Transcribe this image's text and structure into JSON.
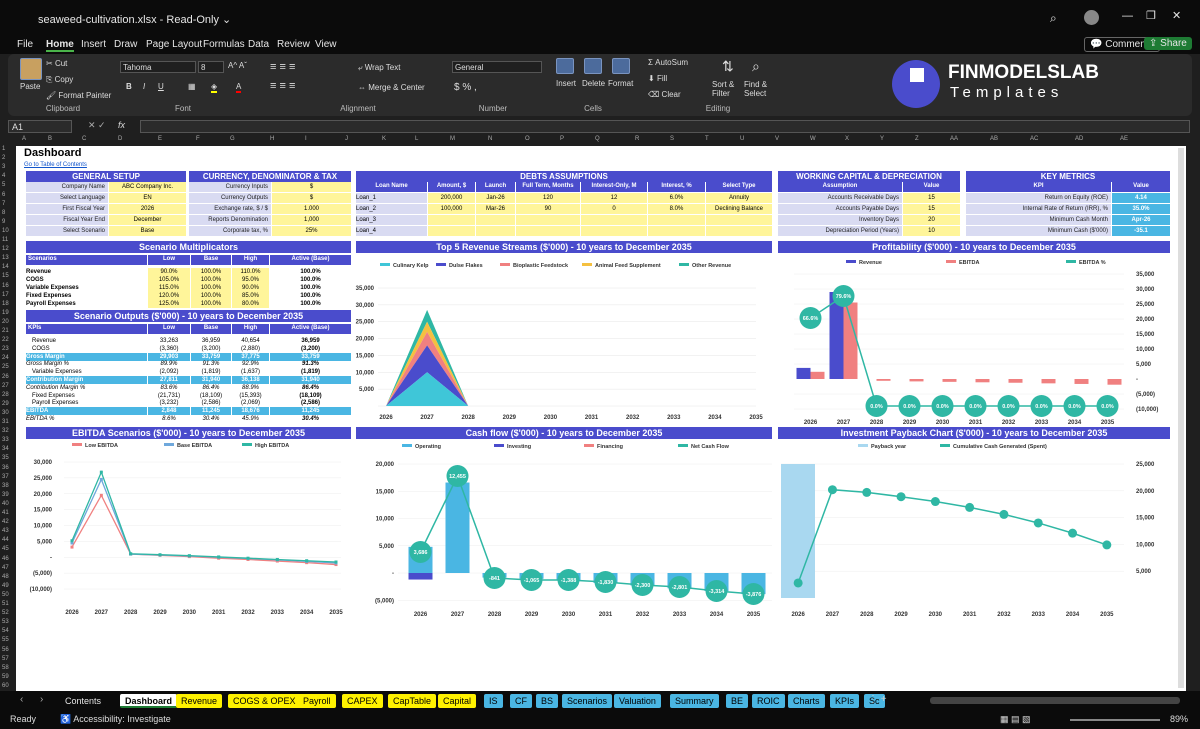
{
  "app": {
    "filename": "seaweed-cultivation.xlsx",
    "mode": "Read-Only",
    "comments_label": "Comments",
    "share_label": "Share"
  },
  "menu": [
    "File",
    "Home",
    "Insert",
    "Draw",
    "Page Layout",
    "Formulas",
    "Data",
    "Review",
    "View"
  ],
  "ribbon": {
    "paste": "Paste",
    "cut": "Cut",
    "copy": "Copy",
    "format_painter": "Format Painter",
    "clipboard": "Clipboard",
    "font_name": "Tahoma",
    "font_size": "8",
    "font": "Font",
    "wrap_text": "Wrap Text",
    "merge_center": "Merge & Center",
    "alignment": "Alignment",
    "number_format": "General",
    "number": "Number",
    "insert": "Insert",
    "delete": "Delete",
    "format": "Format",
    "cells": "Cells",
    "autosum": "AutoSum",
    "fill": "Fill",
    "clear": "Clear",
    "sort_filter": "Sort & Filter",
    "find_select": "Find & Select",
    "editing": "Editing",
    "brand_top": "FINMODELSLAB",
    "brand_bottom": "Templates"
  },
  "formula_bar": {
    "cell_ref": "A1",
    "fx": "fx"
  },
  "columns": [
    "A",
    "B",
    "C",
    "D",
    "E",
    "F",
    "G",
    "H",
    "I",
    "J",
    "K",
    "L",
    "M",
    "N",
    "O",
    "P",
    "Q",
    "R",
    "S",
    "T",
    "U",
    "V",
    "W",
    "X",
    "Y",
    "Z",
    "AA",
    "AB",
    "AC",
    "AD",
    "AE"
  ],
  "sheet": {
    "title": "Dashboard",
    "toc_link": "Go to Table of Contents",
    "general": {
      "title": "GENERAL SETUP",
      "rows": [
        [
          "Company Name",
          "ABC Company Inc."
        ],
        [
          "Select Language",
          "EN"
        ],
        [
          "First Fiscal Year",
          "2026"
        ],
        [
          "Fiscal Year End",
          "December"
        ],
        [
          "Select Scenario",
          "Base"
        ]
      ]
    },
    "currency": {
      "title": "CURRENCY, DENOMINATOR & TAX",
      "rows": [
        [
          "Currency Inputs",
          "$"
        ],
        [
          "Currency Outputs",
          "$"
        ],
        [
          "Exchange rate, $ / $",
          "1.000"
        ],
        [
          "Reports Denomination",
          "1,000"
        ],
        [
          "Corporate tax, %",
          "25%"
        ]
      ]
    },
    "debts": {
      "title": "DEBTS ASSUMPTIONS",
      "headers": [
        "Loan Name",
        "Amount, $",
        "Launch",
        "Full Term, Months",
        "Interest-Only, M",
        "Interest, %",
        "Select Type"
      ],
      "rows": [
        [
          "Loan_1",
          "200,000",
          "Jan-26",
          "120",
          "12",
          "6.0%",
          "Annuity"
        ],
        [
          "Loan_2",
          "100,000",
          "Mar-26",
          "90",
          "0",
          "8.0%",
          "Declining Balance"
        ],
        [
          "Loan_3",
          "",
          "",
          "",
          "",
          "",
          ""
        ],
        [
          "Loan_4",
          "",
          "",
          "",
          "",
          "",
          ""
        ]
      ]
    },
    "wc": {
      "title": "WORKING CAPITAL & DEPRECIATION",
      "headers": [
        "Assumption",
        "Value"
      ],
      "rows": [
        [
          "Accounts Receivable Days",
          "15"
        ],
        [
          "Accounts Payable Days",
          "15"
        ],
        [
          "Inventory Days",
          "20"
        ],
        [
          "Depreciation Period (Years)",
          "10"
        ]
      ]
    },
    "kpi": {
      "title": "KEY METRICS",
      "headers": [
        "KPI",
        "Value"
      ],
      "rows": [
        [
          "Return on Equity (ROE)",
          "4.14"
        ],
        [
          "Internal Rate of Return (IRR), %",
          "35.0%"
        ],
        [
          "Minimum Cash Month",
          "Apr-26"
        ],
        [
          "Minimum Cash ($'000)",
          "-35.1"
        ]
      ]
    },
    "multipliers": {
      "title": "Scenario Multiplicators",
      "headers": [
        "Scenarios",
        "Low",
        "Base",
        "High",
        "Active (Base)"
      ],
      "rows": [
        [
          "Revenue",
          "90.0%",
          "100.0%",
          "110.0%",
          "100.0%"
        ],
        [
          "COGS",
          "105.0%",
          "100.0%",
          "95.0%",
          "100.0%"
        ],
        [
          "Variable Expenses",
          "115.0%",
          "100.0%",
          "90.0%",
          "100.0%"
        ],
        [
          "Fixed Expenses",
          "120.0%",
          "100.0%",
          "85.0%",
          "100.0%"
        ],
        [
          "Payroll Expenses",
          "125.0%",
          "100.0%",
          "80.0%",
          "100.0%"
        ]
      ]
    },
    "outputs": {
      "title": "Scenario Outputs ($'000) - 10 years to December 2035",
      "headers": [
        "KPIs",
        "Low",
        "Base",
        "High",
        "Active (Base)"
      ],
      "rows": [
        [
          "Revenue",
          "33,263",
          "36,959",
          "40,654",
          "36,959",
          ""
        ],
        [
          "COGS",
          "(3,360)",
          "(3,200)",
          "(2,880)",
          "(3,200)",
          ""
        ],
        [
          "Gross Margin",
          "29,903",
          "33,759",
          "37,775",
          "33,759",
          "hl"
        ],
        [
          "Gross Margin %",
          "89.9%",
          "91.3%",
          "92.9%",
          "91.3%",
          "it"
        ],
        [
          "Variable Expenses",
          "(2,092)",
          "(1,819)",
          "(1,637)",
          "(1,819)",
          ""
        ],
        [
          "Contribution Margin",
          "27,811",
          "31,940",
          "36,138",
          "31,940",
          "hl"
        ],
        [
          "Contribution Margin %",
          "83.6%",
          "86.4%",
          "88.9%",
          "86.4%",
          "it"
        ],
        [
          "Fixed Expenses",
          "(21,731)",
          "(18,109)",
          "(15,393)",
          "(18,109)",
          ""
        ],
        [
          "Payroll Expenses",
          "(3,232)",
          "(2,586)",
          "(2,069)",
          "(2,586)",
          ""
        ],
        [
          "EBITDA",
          "2,848",
          "11,245",
          "18,676",
          "11,245",
          "hl"
        ],
        [
          "EBITDA %",
          "8.6%",
          "30.4%",
          "45.9%",
          "30.4%",
          "it"
        ]
      ]
    }
  },
  "charts": {
    "top5": {
      "title": "Top 5 Revenue Streams ($'000) - 10 years to December 2035"
    },
    "profit": {
      "title": "Profitability ($'000) - 10 years to December 2035"
    },
    "ebitda": {
      "title": "EBITDA Scenarios ($'000) - 10 years to December 2035"
    },
    "cash": {
      "title": "Cash flow ($'000) - 10 years to December 2035"
    },
    "payback": {
      "title": "Investment Payback Chart ($'000) - 10 years to December 2035"
    }
  },
  "chart_data": [
    {
      "type": "area",
      "title": "Top 5 Revenue Streams ($'000) - 10 years to December 2035",
      "categories": [
        "2026",
        "2027",
        "2028",
        "2029",
        "2030",
        "2031",
        "2032",
        "2033",
        "2034",
        "2035"
      ],
      "ylim": [
        0,
        35000
      ],
      "series": [
        {
          "name": "Culinary Kelp",
          "color": "#3fc6d8",
          "values": [
            0,
            10000,
            0,
            0,
            0,
            0,
            0,
            0,
            0,
            0
          ]
        },
        {
          "name": "Dulse Flakes",
          "color": "#4a4ccc",
          "values": [
            0,
            8000,
            0,
            0,
            0,
            0,
            0,
            0,
            0,
            0
          ]
        },
        {
          "name": "Bioplastic Feedstock",
          "color": "#f08080",
          "values": [
            0,
            4000,
            0,
            0,
            0,
            0,
            0,
            0,
            0,
            0
          ]
        },
        {
          "name": "Animal Feed Supplement",
          "color": "#f5c040",
          "values": [
            0,
            3000,
            0,
            0,
            0,
            0,
            0,
            0,
            0,
            0
          ]
        },
        {
          "name": "Other Revenue",
          "color": "#2fb7a4",
          "values": [
            0,
            3500,
            0,
            0,
            0,
            0,
            0,
            0,
            0,
            0
          ]
        }
      ]
    },
    {
      "type": "bar",
      "title": "Profitability ($'000) - 10 years to December 2035",
      "categories": [
        "2026",
        "2027",
        "2028",
        "2029",
        "2030",
        "2031",
        "2032",
        "2033",
        "2034",
        "2035"
      ],
      "ylim": [
        -10000,
        35000
      ],
      "series": [
        {
          "name": "Revenue",
          "color": "#4a4ccc",
          "values": [
            3700,
            29000,
            0,
            0,
            0,
            0,
            0,
            0,
            0,
            0
          ]
        },
        {
          "name": "EBITDA",
          "color": "#f08080",
          "values": [
            2400,
            25500,
            -600,
            -800,
            -950,
            -1100,
            -1250,
            -1450,
            -1650,
            -1900
          ]
        },
        {
          "name": "EBITDA %",
          "color": "#2fb7a4",
          "values": [
            66.6,
            79.6,
            0,
            0,
            0,
            0,
            0,
            0,
            0,
            0
          ],
          "labels": [
            "66.6%",
            "79.6%",
            "0.0%",
            "0.0%",
            "0.0%",
            "0.0%",
            "0.0%",
            "0.0%",
            "0.0%",
            "0.0%"
          ]
        }
      ]
    },
    {
      "type": "line",
      "title": "EBITDA Scenarios ($'000) - 10 years to December 2035",
      "categories": [
        "2026",
        "2027",
        "2028",
        "2029",
        "2030",
        "2031",
        "2032",
        "2033",
        "2034",
        "2035"
      ],
      "ylim": [
        -10000,
        30000
      ],
      "series": [
        {
          "name": "Low EBITDA",
          "color": "#f08080",
          "values": [
            3200,
            19500,
            1000,
            600,
            200,
            -300,
            -700,
            -1200,
            -1700,
            -2300
          ]
        },
        {
          "name": "Base EBITDA",
          "color": "#6fa8dc",
          "values": [
            4500,
            24500,
            1000,
            700,
            400,
            0,
            -400,
            -800,
            -1300,
            -1800
          ]
        },
        {
          "name": "High EBITDA",
          "color": "#2fb7a4",
          "values": [
            5200,
            26800,
            1100,
            800,
            500,
            100,
            -300,
            -700,
            -1100,
            -1500
          ]
        }
      ]
    },
    {
      "type": "bar",
      "title": "Cash flow ($'000) - 10 years to December 2035",
      "categories": [
        "2026",
        "2027",
        "2028",
        "2029",
        "2030",
        "2031",
        "2032",
        "2033",
        "2034",
        "2035"
      ],
      "ylim": [
        -5000,
        20000
      ],
      "series": [
        {
          "name": "Operating",
          "color": "#4ab6e3",
          "values": [
            4800,
            16600,
            -841,
            -1065,
            -1388,
            -1830,
            -2300,
            -2801,
            -3314,
            -3876
          ]
        },
        {
          "name": "Investing",
          "color": "#4a4ccc",
          "values": [
            -1200,
            0,
            0,
            0,
            0,
            0,
            0,
            0,
            0,
            0
          ]
        },
        {
          "name": "Financing",
          "color": "#f08080",
          "values": [
            0,
            0,
            0,
            0,
            0,
            0,
            0,
            0,
            0,
            0
          ]
        },
        {
          "name": "Net Cash Flow",
          "color": "#2fb7a4",
          "values": [
            3686,
            17455,
            -841,
            -1065,
            -1388,
            -1830,
            -2300,
            -2801,
            -3314,
            -3876
          ],
          "labels": [
            "3,686",
            "12,455",
            "-841",
            "-1,065",
            "-1,388",
            "-1,830",
            "-2,300",
            "-2,801",
            "-3,314",
            "-3,876"
          ]
        }
      ]
    },
    {
      "type": "line",
      "title": "Investment Payback Chart ($'000) - 10 years to December 2035",
      "categories": [
        "2026",
        "2027",
        "2028",
        "2029",
        "2030",
        "2031",
        "2032",
        "2033",
        "2034",
        "2035"
      ],
      "ylim": [
        0,
        25000
      ],
      "series": [
        {
          "name": "Payback year",
          "color": "#a9d8f0",
          "values": [
            1,
            0,
            0,
            0,
            0,
            0,
            0,
            0,
            0,
            0
          ]
        },
        {
          "name": "Cumulative Cash Generated (Spent)",
          "color": "#2fb7a4",
          "values": [
            2800,
            20200,
            19700,
            18900,
            18000,
            16900,
            15600,
            14000,
            12100,
            9900
          ]
        }
      ]
    }
  ],
  "tabs": [
    {
      "label": "Contents",
      "color": "#0b0b0b",
      "fg": "#e6e6e6"
    },
    {
      "label": "Dashboard",
      "color": "#ffffff",
      "fg": "#000"
    },
    {
      "label": "Revenue",
      "color": "#fff200",
      "fg": "#000"
    },
    {
      "label": "COGS & OPEX",
      "color": "#fff200",
      "fg": "#000"
    },
    {
      "label": "Payroll",
      "color": "#fff200",
      "fg": "#000"
    },
    {
      "label": "CAPEX",
      "color": "#fff200",
      "fg": "#000"
    },
    {
      "label": "CapTable",
      "color": "#fff200",
      "fg": "#000"
    },
    {
      "label": "Capital",
      "color": "#fff200",
      "fg": "#000"
    },
    {
      "label": "IS",
      "color": "#4ab6e3",
      "fg": "#000"
    },
    {
      "label": "CF",
      "color": "#4ab6e3",
      "fg": "#000"
    },
    {
      "label": "BS",
      "color": "#4ab6e3",
      "fg": "#000"
    },
    {
      "label": "Scenarios",
      "color": "#4ab6e3",
      "fg": "#000"
    },
    {
      "label": "Valuation",
      "color": "#4ab6e3",
      "fg": "#000"
    },
    {
      "label": "Summary",
      "color": "#4ab6e3",
      "fg": "#000"
    },
    {
      "label": "BE",
      "color": "#4ab6e3",
      "fg": "#000"
    },
    {
      "label": "ROIC",
      "color": "#4ab6e3",
      "fg": "#000"
    },
    {
      "label": "Charts",
      "color": "#4ab6e3",
      "fg": "#000"
    },
    {
      "label": "KPIs",
      "color": "#4ab6e3",
      "fg": "#000"
    },
    {
      "label": "Sc",
      "color": "#4ab6e3",
      "fg": "#000"
    }
  ],
  "status": {
    "ready": "Ready",
    "accessibility": "Accessibility: Investigate",
    "zoom": "89%"
  }
}
